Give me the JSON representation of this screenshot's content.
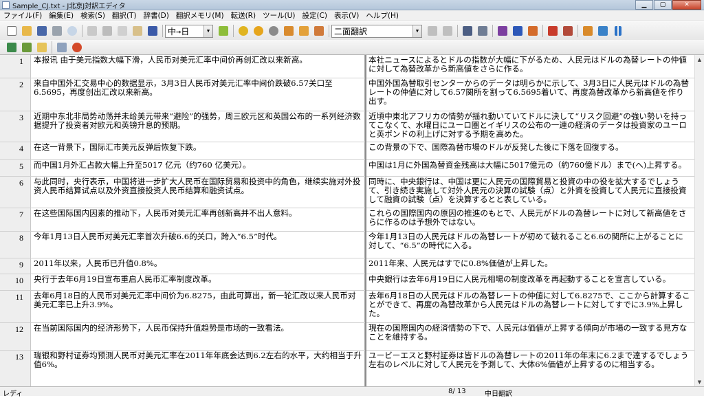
{
  "window": {
    "title": "Sample_CJ.txt - J北京J対訳エディタ"
  },
  "menu": [
    "ファイル(F)",
    "編集(E)",
    "検索(S)",
    "翻訳(T)",
    "辞書(D)",
    "翻訳メモリ(M)",
    "転送(R)",
    "ツール(U)",
    "設定(C)",
    "表示(V)",
    "ヘルプ(H)"
  ],
  "toolbar": {
    "direction": "中→日",
    "view_mode": "二面翻訳"
  },
  "rows": [
    {
      "n": "1",
      "src": "本报讯 由于美元指数大幅下滑，人民币对美元汇率中间价再创汇改以来新高。",
      "tgt": "本社ニュースによるとドルの指数が大幅に下がるため、人民元はドルの為替レートの仲値に対して為替改革から新高値をさらに作る。"
    },
    {
      "n": "2",
      "src": "来自中国外汇交易中心的数据显示，3月3日人民币对美元汇率中间价跌破6.57关口至6.5695，再度创出汇改以来新高。",
      "tgt": "中国外国為替取引センターからのデータは明らかに示して、3月3日に人民元はドルの為替レートの仲値に対して6.57関所を割って6.5695着いて、再度為替改革から新高値を作り出す。"
    },
    {
      "n": "3",
      "src": "近期中东北非局势动荡并未给美元带来“避险”的强势，周三欧元区和英国公布的一系列经济数据提升了投资者对欧元和英镑升息的预期。",
      "tgt": "近頃中東北アフリカの情勢が揺れ動いていてドルに決して“リスク回避”の強い勢いを持ってこなくて、水曜日にユーロ圏とイギリスの公布の一連の経済のデータは投資家のユーロと英ポンドの利上げに対する予期を高めた。"
    },
    {
      "n": "4",
      "src": "在这一背景下，国际汇市美元反弹后恢复下跌。",
      "tgt": "この背景の下で、国際為替市場のドルが反発した後に下落を回復する。"
    },
    {
      "n": "5",
      "src": "而中国1月外汇占款大幅上升至5017 亿元（约760 亿美元）。",
      "tgt": "中国は1月に外国為替資金残高は大幅に5017億元の（約760億ドル）まで(へ)上昇する。"
    },
    {
      "n": "6",
      "src": "与此同时，央行表示，中国将进一步扩大人民币在国际贸易和投资中的角色，继续实施对外投资人民币结算试点以及外资直接投资人民币结算和融资试点。",
      "tgt": "同時に、中央銀行は、中国は更に人民元の国際貿易と投資の中の役を拡大するでしょうて、引き続き実施して対外人民元の決算の試験（点）と外資を投資して人民元に直接投資して融資の試験（点）を決算するとと表している。"
    },
    {
      "n": "7",
      "src": "在这些国际国内因素的推动下，人民币对美元汇率再创新高并不出人意料。",
      "tgt": "これらの国際国内の原因の推進のもとで、人民元がドルの為替レートに対して新高値をさらに作るのは予想外ではない。"
    },
    {
      "n": "8",
      "src": "今年1月13日人民币对美元汇率首次升破6.6的关口，跨入“6.5”时代。",
      "tgt": "今年1月13日の人民元はドルの為替レートが初めて破れること6.6の関所に上がることに対して、“6.5”の時代に入る。"
    },
    {
      "n": "9",
      "src": "2011年以来，人民币已升值0.8%。",
      "tgt": "2011年来、人民元はすでに0.8%価値が上昇した。"
    },
    {
      "n": "10",
      "src": "央行于去年6月19日宣布重启人民币汇率制度改革。",
      "tgt": "中央銀行は去年6月19日に人民元相場の制度改革を再起動することを宣言している。"
    },
    {
      "n": "11",
      "src": "去年6月18日的人民币对美元汇率中间价为6.8275，由此可算出，新一轮汇改以来人民币对美元汇率已上升3.9%。",
      "tgt": "去年6月18日の人民元はドルの為替レートの仲値に対して6.8275で、ここから計算することができて、再度の為替改革から人民元はドルの為替レートに対してすでに3.9%上昇した。"
    },
    {
      "n": "12",
      "src": "在当前国际国内的经济形势下，人民币保持升值趋势是市场的一致看法。",
      "tgt": "現在の国際国内の経済情勢の下で、人民元は価値が上昇する傾向が市場の一致する見方なことを維持する。"
    },
    {
      "n": "13",
      "src": "瑞银和野村证券均预测人民币对美元汇率在2011年年底会达到6.2左右的水平，大约相当于升值6%。",
      "tgt": "ユービーエスと野村証券は皆ドルの為替レートの2011年の年末に6.2まで達するでしょう左右のレベルに対して人民元を予測して、大体6%価値が上昇するのに相当する。"
    }
  ],
  "status": {
    "ready": "レディ",
    "position": "8/ 13",
    "mode": "中日翻訳"
  }
}
